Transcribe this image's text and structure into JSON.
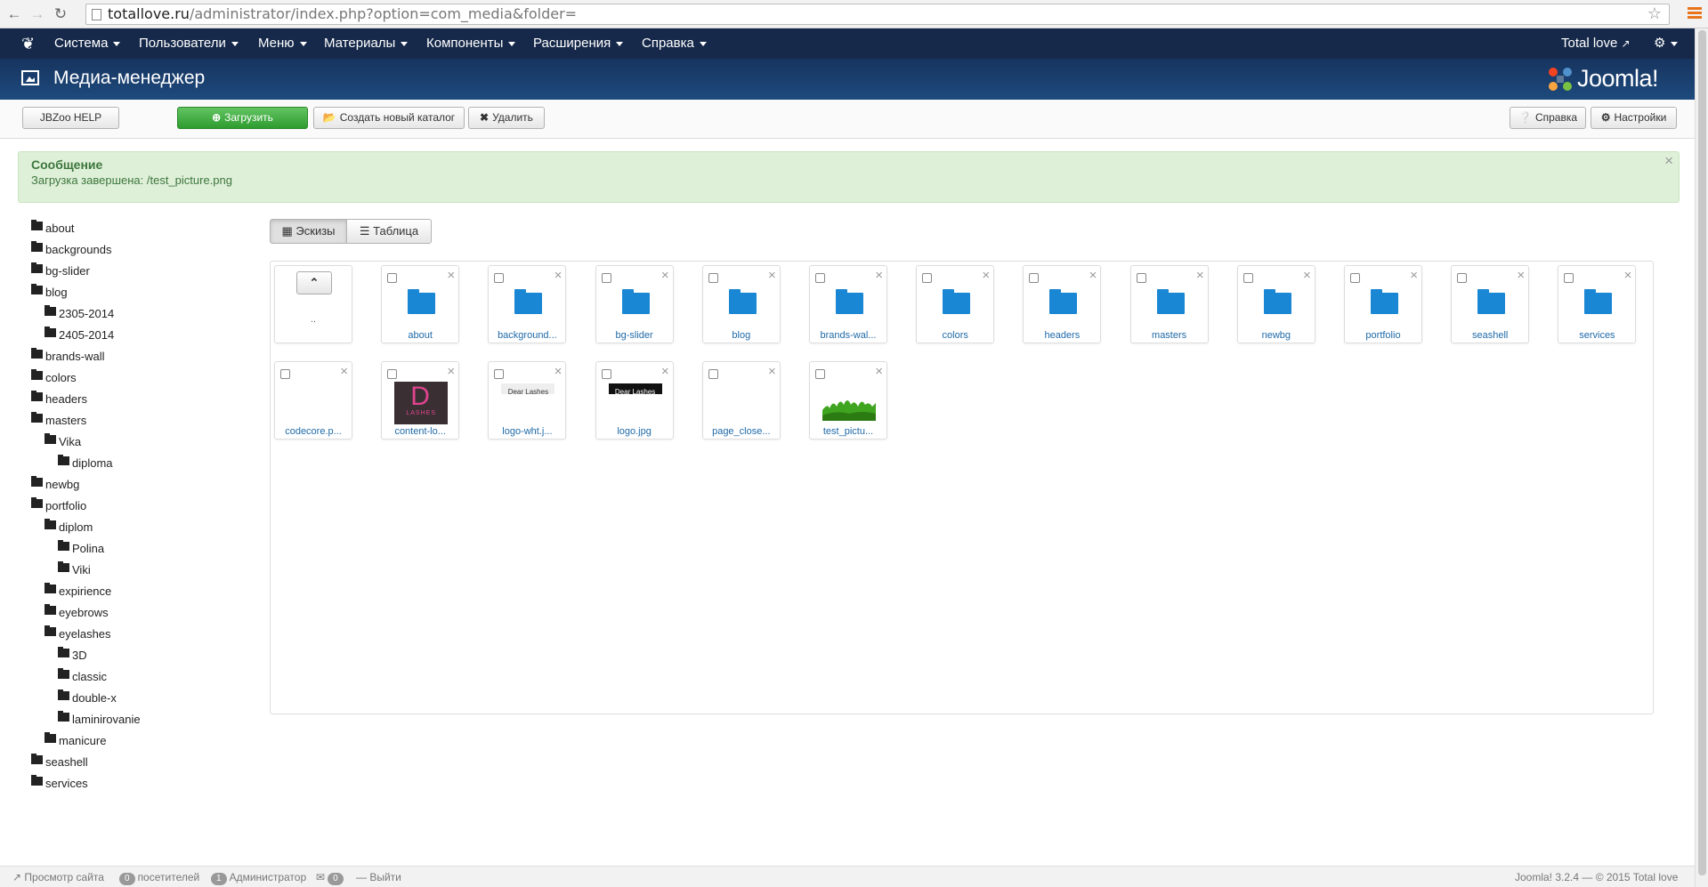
{
  "browser": {
    "url_host": "totallove.ru",
    "url_path": "/administrator/index.php?option=com_media&folder="
  },
  "topnav": {
    "menu": [
      "Система",
      "Пользователи",
      "Меню",
      "Материалы",
      "Компоненты",
      "Расширения",
      "Справка"
    ],
    "site_link": "Total love"
  },
  "header": {
    "title": "Медиа-менеджер",
    "brand": "Joomla!"
  },
  "toolbar": {
    "jbzoo_help": "JBZoo HELP",
    "upload": "Загрузить",
    "new_folder": "Создать новый каталог",
    "delete": "Удалить",
    "help": "Справка",
    "settings": "Настройки"
  },
  "message": {
    "heading": "Сообщение",
    "text": "Загрузка завершена: /test_picture.png"
  },
  "view": {
    "thumbs": "Эскизы",
    "table": "Таблица"
  },
  "tree": [
    {
      "label": "about",
      "level": 0
    },
    {
      "label": "backgrounds",
      "level": 0
    },
    {
      "label": "bg-slider",
      "level": 0
    },
    {
      "label": "blog",
      "level": 0
    },
    {
      "label": "2305-2014",
      "level": 1
    },
    {
      "label": "2405-2014",
      "level": 1
    },
    {
      "label": "brands-wall",
      "level": 0
    },
    {
      "label": "colors",
      "level": 0
    },
    {
      "label": "headers",
      "level": 0
    },
    {
      "label": "masters",
      "level": 0
    },
    {
      "label": "Vika",
      "level": 1
    },
    {
      "label": "diploma",
      "level": 2
    },
    {
      "label": "newbg",
      "level": 0
    },
    {
      "label": "portfolio",
      "level": 0
    },
    {
      "label": "diplom",
      "level": 1
    },
    {
      "label": "Polina",
      "level": 2
    },
    {
      "label": "Viki",
      "level": 2
    },
    {
      "label": "expirience",
      "level": 1
    },
    {
      "label": "eyebrows",
      "level": 1
    },
    {
      "label": "eyelashes",
      "level": 1
    },
    {
      "label": "3D",
      "level": 2
    },
    {
      "label": "classic",
      "level": 2
    },
    {
      "label": "double-x",
      "level": 2
    },
    {
      "label": "laminirovanie",
      "level": 2
    },
    {
      "label": "manicure",
      "level": 1
    },
    {
      "label": "seashell",
      "level": 0
    },
    {
      "label": "services",
      "level": 0
    }
  ],
  "grid": {
    "up_label": "..",
    "folders": [
      "about",
      "background...",
      "bg-slider",
      "blog",
      "brands-wal...",
      "colors",
      "headers",
      "masters",
      "newbg",
      "portfolio",
      "seashell",
      "services"
    ],
    "files": [
      {
        "label": "codecore.p...",
        "kind": "blank"
      },
      {
        "label": "content-lo...",
        "kind": "logo-dark",
        "logo_text": "LASHES"
      },
      {
        "label": "logo-wht.j...",
        "kind": "logo-white",
        "logo_text": "Dear Lashes"
      },
      {
        "label": "logo.jpg",
        "kind": "logo-black",
        "logo_text": "Dear Lashes"
      },
      {
        "label": "page_close...",
        "kind": "blank"
      },
      {
        "label": "test_pictu...",
        "kind": "grass"
      }
    ]
  },
  "footer": {
    "view_site": "Просмотр сайта",
    "visitors_count": "0",
    "visitors_label": "посетителей",
    "admins_count": "1",
    "admins_label": "Администратор",
    "messages_count": "0",
    "logout": "Выйти",
    "version": "Joomla! 3.2.4 — © 2015 Total love"
  }
}
